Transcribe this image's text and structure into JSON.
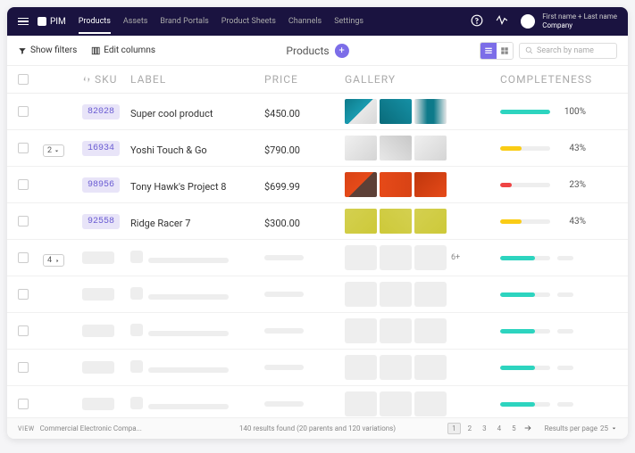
{
  "header": {
    "app_name": "PIM",
    "nav": [
      "Products",
      "Assets",
      "Brand Portals",
      "Product Sheets",
      "Channels",
      "Settings"
    ],
    "active_nav": 0,
    "user_name": "First name + Last name",
    "company": "Company"
  },
  "toolbar": {
    "show_filters": "Show filters",
    "edit_columns": "Edit columns",
    "page_title": "Products",
    "search_placeholder": "Search by name"
  },
  "columns": {
    "sku": "SKU",
    "label": "LABEL",
    "price": "PRICE",
    "gallery": "GALLERY",
    "completeness": "COMPLETENESS"
  },
  "rows": [
    {
      "sku": "82028",
      "label": "Super cool product",
      "price": "$450.00",
      "thumbs": [
        "teal",
        "teal2",
        "teal3"
      ],
      "progress": 100,
      "color": "#2dd4bf",
      "expand": null
    },
    {
      "sku": "16934",
      "label": "Yoshi Touch & Go",
      "price": "$790.00",
      "thumbs": [
        "grey",
        "grey2",
        "grey"
      ],
      "progress": 43,
      "color": "#facc15",
      "expand": "2"
    },
    {
      "sku": "98956",
      "label": "Tony Hawk's Project 8",
      "price": "$699.99",
      "thumbs": [
        "orange",
        "orange2",
        "orange3"
      ],
      "progress": 23,
      "color": "#ef4444",
      "expand": null
    },
    {
      "sku": "92558",
      "label": "Ridge Racer 7",
      "price": "$300.00",
      "thumbs": [
        "yellow",
        "yellow2",
        "yellow"
      ],
      "progress": 43,
      "color": "#facc15",
      "expand": null
    }
  ],
  "skeleton_rows": [
    {
      "expand": "4",
      "more": "6+"
    },
    {
      "expand": null,
      "more": null
    },
    {
      "expand": null,
      "more": null
    },
    {
      "expand": null,
      "more": null
    },
    {
      "expand": null,
      "more": null
    }
  ],
  "footer": {
    "view_label": "VIEW",
    "breadcrumb": "Commercial Electronic Compa...",
    "results": "140 results found (20 parents and 120 variations)",
    "pages": [
      "1",
      "2",
      "3",
      "4",
      "5"
    ],
    "active_page": 0,
    "rpp_label": "Results per page",
    "rpp_value": "25"
  }
}
